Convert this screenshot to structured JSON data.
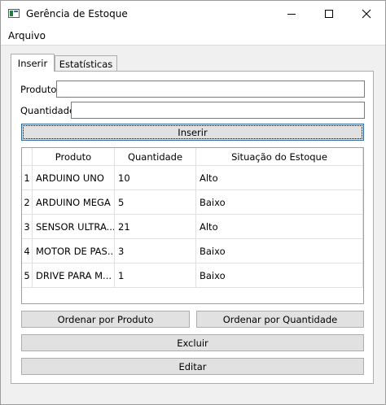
{
  "window": {
    "title": "Gerência de Estoque"
  },
  "menu": {
    "items": [
      "Arquivo"
    ]
  },
  "tabs": [
    "Inserir",
    "Estatísticas"
  ],
  "form": {
    "produto_label": "Produto",
    "produto_value": "",
    "quantidade_label": "Quantidade",
    "quantidade_value": "",
    "insert_button": "Inserir"
  },
  "table": {
    "headers": [
      "Produto",
      "Quantidade",
      "Situação do Estoque"
    ],
    "rows": [
      {
        "num": "1",
        "produto": "ARDUINO UNO",
        "quantidade": "10",
        "situacao": "Alto"
      },
      {
        "num": "2",
        "produto": "ARDUINO MEGA",
        "quantidade": "5",
        "situacao": "Baixo"
      },
      {
        "num": "3",
        "produto": "SENSOR ULTRA...",
        "quantidade": "21",
        "situacao": "Alto"
      },
      {
        "num": "4",
        "produto": "MOTOR DE PAS...",
        "quantidade": "3",
        "situacao": "Baixo"
      },
      {
        "num": "5",
        "produto": "DRIVE PARA M...",
        "quantidade": "1",
        "situacao": "Baixo"
      }
    ]
  },
  "buttons": {
    "sort_product": "Ordenar por Produto",
    "sort_quantity": "Ordenar por Quantidade",
    "delete": "Excluir",
    "edit": "Editar"
  },
  "icons": {
    "app": "spreadsheet-icon",
    "minimize": "minimize-icon",
    "maximize": "maximize-icon",
    "close": "close-icon"
  }
}
